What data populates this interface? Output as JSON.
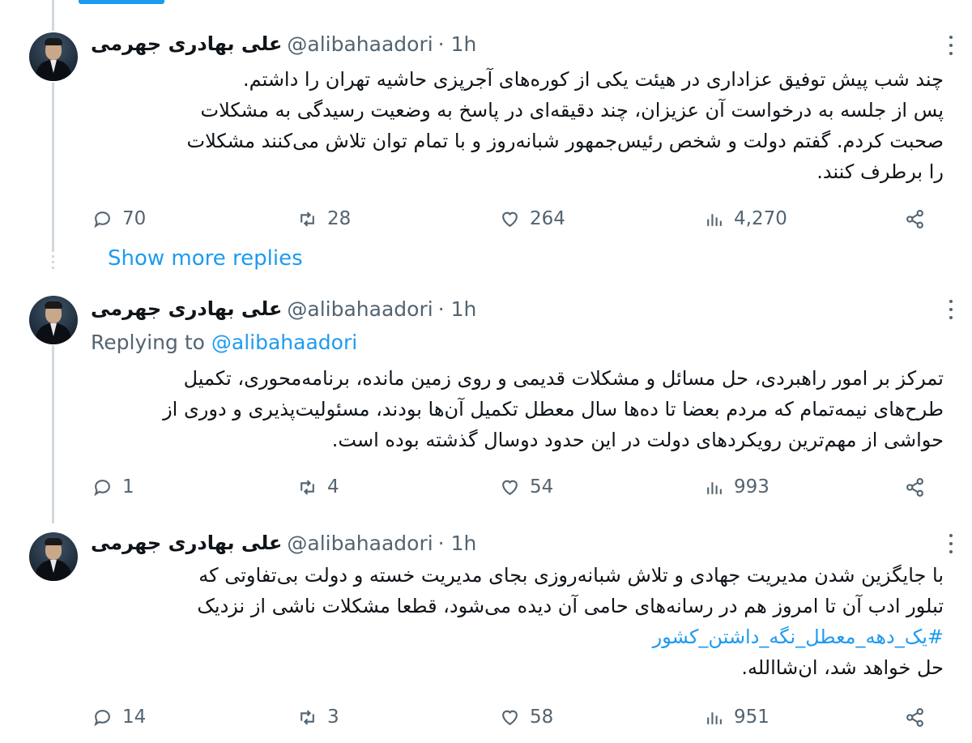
{
  "tweets": [
    {
      "name": "علی بهادری جهرمی",
      "handle": "@alibahaadori",
      "time": "· 1h",
      "lines": [
        "چند شب پیش توفیق عزاداری در هیئت یکی از کوره‌های آجرپزی حاشیه تهران را داشتم.",
        "پس از جلسه به درخواست آن عزیزان، چند دقیقه‌ای در پاسخ به وضعیت رسیدگی به مشکلات",
        "صحبت کردم. گفتم دولت و شخص رئیس‌جمهور شبانه‌روز و با تمام توان تلاش می‌کنند مشکلات",
        "را برطرف کنند."
      ],
      "replies": "70",
      "retweets": "28",
      "likes": "264",
      "views": "4,270"
    },
    {
      "name": "علی بهادری جهرمی",
      "handle": "@alibahaadori",
      "time": "· 1h",
      "replying_prefix": "Replying to",
      "replying_to": "@alibahaadori",
      "lines": [
        "تمرکز بر امور راهبردی، حل مسائل و مشکلات قدیمی و روی زمین مانده، برنامه‌محوری، تکمیل",
        "طرح‌های نیمه‌تمام که مردم بعضا تا ده‌ها سال معطل تکمیل آن‌ها بودند، مسئولیت‌پذیری و دوری از",
        "حواشی از مهم‌ترین رویکردهای دولت در این حدود دوسال گذشته بوده است."
      ],
      "replies": "1",
      "retweets": "4",
      "likes": "54",
      "views": "993"
    },
    {
      "name": "علی بهادری جهرمی",
      "handle": "@alibahaadori",
      "time": "· 1h",
      "lines": [
        "با جایگزین شدن مدیریت جهادی و تلاش شبانه‌روزی بجای مدیریت خسته و دولت بی‌تفاوتی که",
        "تبلور ادب آن تا امروز هم در رسانه‌های حامی آن دیده می‌شود، قطعا مشکلات ناشی از نزدیک"
      ],
      "hashtag": "#یک_دهه_معطل_نگه_داشتن_کشور",
      "last_line": "حل خواهد شد، ان‌شاالله.",
      "replies": "14",
      "retweets": "3",
      "likes": "58",
      "views": "951"
    }
  ],
  "show_more_replies": "Show more replies",
  "colors": {
    "accent": "#1d9bf0",
    "muted": "#536471",
    "text": "#0f1419",
    "thread_line": "#cfd9de"
  }
}
